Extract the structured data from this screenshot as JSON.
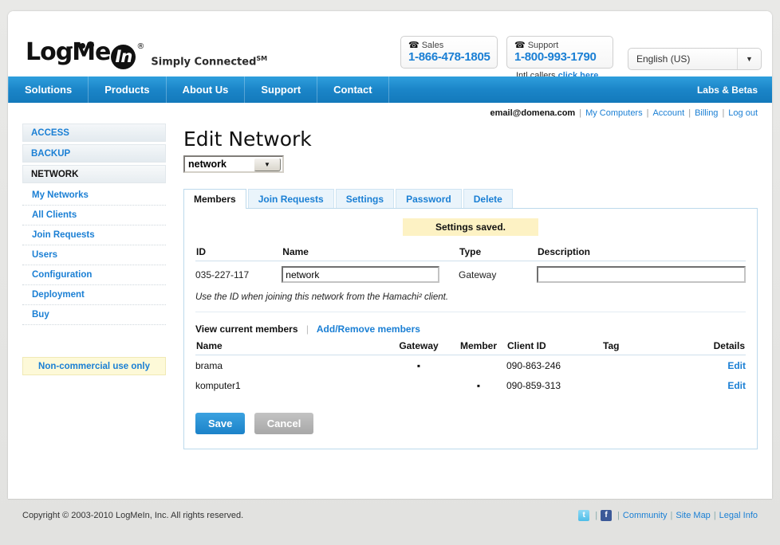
{
  "header": {
    "logo": {
      "part1": "Log",
      "part2": "Me",
      "part3": "In",
      "reg": "®",
      "tagline": "Simply Connected",
      "tagline_sup": "SM"
    },
    "sales": {
      "label": "Sales",
      "number": "1-866-478-1805",
      "icon": "telephone-icon"
    },
    "support": {
      "label": "Support",
      "number": "1-800-993-1790",
      "icon": "telephone-icon"
    },
    "intl": {
      "text": "Intl callers",
      "link": "click here"
    },
    "language": {
      "value": "English (US)",
      "arrow": "▼"
    }
  },
  "nav": {
    "items": [
      "Solutions",
      "Products",
      "About Us",
      "Support",
      "Contact"
    ],
    "right": "Labs & Betas"
  },
  "account_bar": {
    "email": "email@domena.com",
    "links": [
      "My Computers",
      "Account",
      "Billing",
      "Log out"
    ],
    "separator": "|"
  },
  "sidebar": {
    "sections": [
      {
        "label": "ACCESS",
        "active": false
      },
      {
        "label": "BACKUP",
        "active": false
      },
      {
        "label": "NETWORK",
        "active": true
      }
    ],
    "items": [
      "My Networks",
      "All Clients",
      "Join Requests",
      "Users",
      "Configuration",
      "Deployment",
      "Buy"
    ],
    "notice": "Non-commercial use only"
  },
  "main": {
    "title": "Edit Network",
    "network_select": {
      "value": "network",
      "arrow": "▼"
    },
    "tabs": [
      {
        "label": "Members",
        "active": true
      },
      {
        "label": "Join Requests",
        "active": false
      },
      {
        "label": "Settings",
        "active": false
      },
      {
        "label": "Password",
        "active": false
      },
      {
        "label": "Delete",
        "active": false
      }
    ],
    "saved_message": "Settings saved.",
    "form": {
      "headers": [
        "ID",
        "Name",
        "Type",
        "Description"
      ],
      "id_value": "035-227-117",
      "name_value": "network",
      "type_value": "Gateway",
      "description_value": ""
    },
    "hint": "Use the ID when joining this network from the Hamachi² client.",
    "member_links": {
      "current": "View current members",
      "add_remove": "Add/Remove members",
      "divider": "|"
    },
    "members_table": {
      "headers": [
        "Name",
        "Gateway",
        "Member",
        "Client ID",
        "Tag",
        "Details"
      ],
      "rows": [
        {
          "name": "brama",
          "gateway": "▪",
          "member": "",
          "client_id": "090-863-246",
          "tag": "",
          "details": "Edit"
        },
        {
          "name": "komputer1",
          "gateway": "",
          "member": "▪",
          "client_id": "090-859-313",
          "tag": "",
          "details": "Edit"
        }
      ]
    },
    "buttons": {
      "save": "Save",
      "cancel": "Cancel"
    }
  },
  "footer": {
    "copyright": "Copyright © 2003-2010 LogMeIn, Inc. All rights reserved.",
    "social": [
      {
        "name": "twitter-icon",
        "glyph": "t"
      },
      {
        "name": "facebook-icon",
        "glyph": "f"
      }
    ],
    "links": [
      "Community",
      "Site Map",
      "Legal Info"
    ],
    "separator": "|"
  },
  "colors": {
    "brand_blue": "#1a7fd4",
    "nav_blue": "#1b85c8",
    "notice_yellow": "#fdf9d8",
    "saved_yellow": "#fdf2c4"
  }
}
